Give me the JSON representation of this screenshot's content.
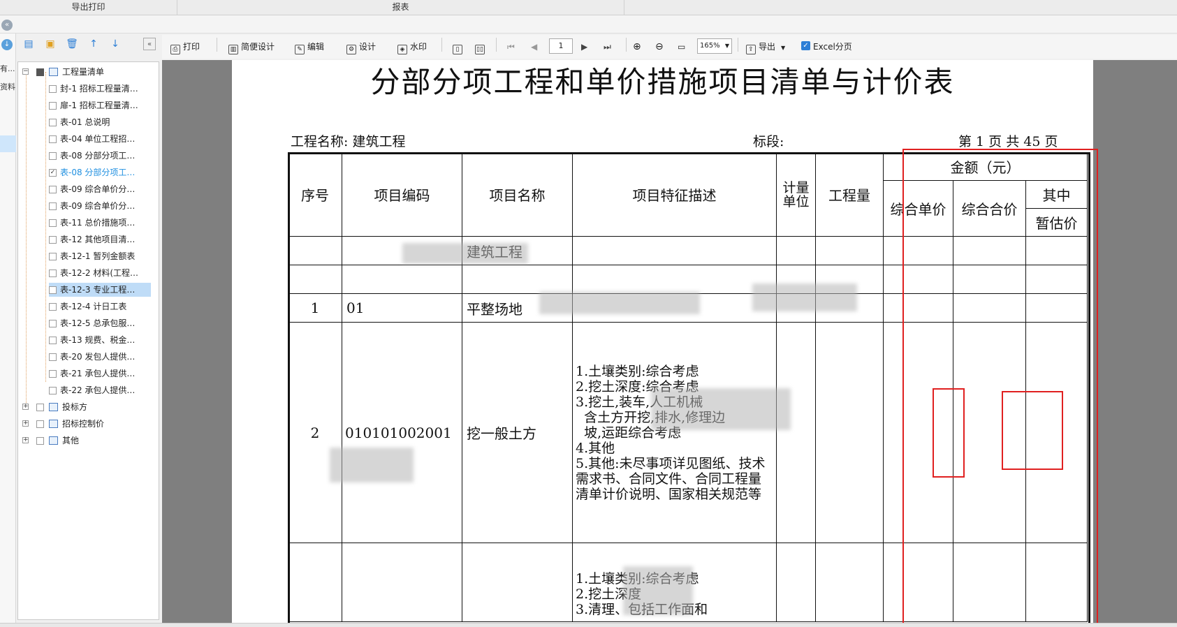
{
  "tabs": {
    "export_print": "导出打印",
    "report": "报表"
  },
  "left_strip": {
    "item1": "有...",
    "item2": "资料..."
  },
  "tree": {
    "root": "工程量清单",
    "children": [
      "封-1 招标工程量清…",
      "扉-1 招标工程量清…",
      "表-01 总说明",
      "表-04 单位工程招…",
      "表-08 分部分项工…",
      "表-08 分部分项工…",
      "表-09 综合单价分…",
      "表-09 综合单价分…",
      "表-11 总价措施项…",
      "表-12 其他项目清…",
      "表-12-1 暂列金额表",
      "表-12-2 材料(工程…",
      "表-12-3 专业工程…",
      "表-12-4 计日工表",
      "表-12-5 总承包服…",
      "表-13 规费、税金…",
      "表-20 发包人提供…",
      "表-21 承包人提供…",
      "表-22 承包人提供…"
    ],
    "groups": [
      "投标方",
      "招标控制价",
      "其他"
    ]
  },
  "toolbar": {
    "print": "打印",
    "simple_design": "简便设计",
    "edit": "编辑",
    "design": "设计",
    "watermark": "水印",
    "page": "1",
    "zoom": "165%",
    "export": "导出",
    "excel_paging": "Excel分页"
  },
  "report": {
    "title": "分部分项工程和单价措施项目清单与计价表",
    "project_label": "工程名称: 建筑工程",
    "section_label": "标段:",
    "page_label": "第 1 页   共 45 页",
    "headers": {
      "seq": "序号",
      "code": "项目编码",
      "name": "项目名称",
      "desc": "项目特征描述",
      "unit": "计量单位",
      "qty": "工程量",
      "amount": "金额（元）",
      "unit_price": "综合单价",
      "total_price": "综合合价",
      "of_which": "其中",
      "provisional": "暂估价"
    },
    "rows": [
      {
        "seq": "",
        "code": "",
        "name": "建筑工程",
        "desc": ""
      },
      {
        "seq": "",
        "code": "",
        "name": "",
        "desc": ""
      },
      {
        "seq": "1",
        "code": "01",
        "name": "平整场地",
        "desc": ""
      },
      {
        "seq": "2",
        "code": "010101002001",
        "name": "挖一般土方",
        "desc": "1.土壤类别:综合考虑\n2.挖土深度:综合考虑\n3.挖土,装车,人工机械\n  含土方开挖,排水,修理边\n  坡,运距综合考虑\n4.其他\n5.其他:未尽事项详见图纸、技术需求书、合同文件、合同工程量清单计价说明、国家相关规范等"
      },
      {
        "seq": "",
        "code": "",
        "name": "",
        "desc": "1.土壤类别:综合考虑\n2.挖土深度\n3.清理、包括工作面和"
      }
    ]
  }
}
